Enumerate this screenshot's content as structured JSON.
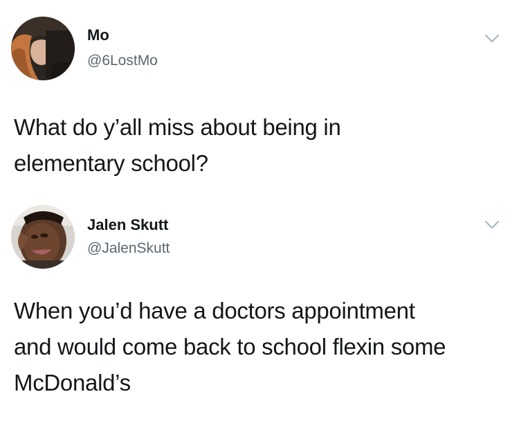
{
  "tweets": [
    {
      "author": {
        "name": "Mo",
        "handle": "@6LostMo"
      },
      "text_lines": [
        "What do y’all miss about being in",
        "elementary school?"
      ],
      "menu_icon": "chevron-down-icon"
    },
    {
      "author": {
        "name": "Jalen Skutt",
        "handle": "@JalenSkutt"
      },
      "text_lines": [
        "When you’d have a doctors appointment",
        "and would come back to school flexin some",
        "McDonald’s"
      ],
      "menu_icon": "chevron-down-icon"
    }
  ],
  "colors": {
    "name": "#14171a",
    "handle": "#5b6770",
    "chevron": "#aab8c2",
    "background": "#ffffff"
  }
}
